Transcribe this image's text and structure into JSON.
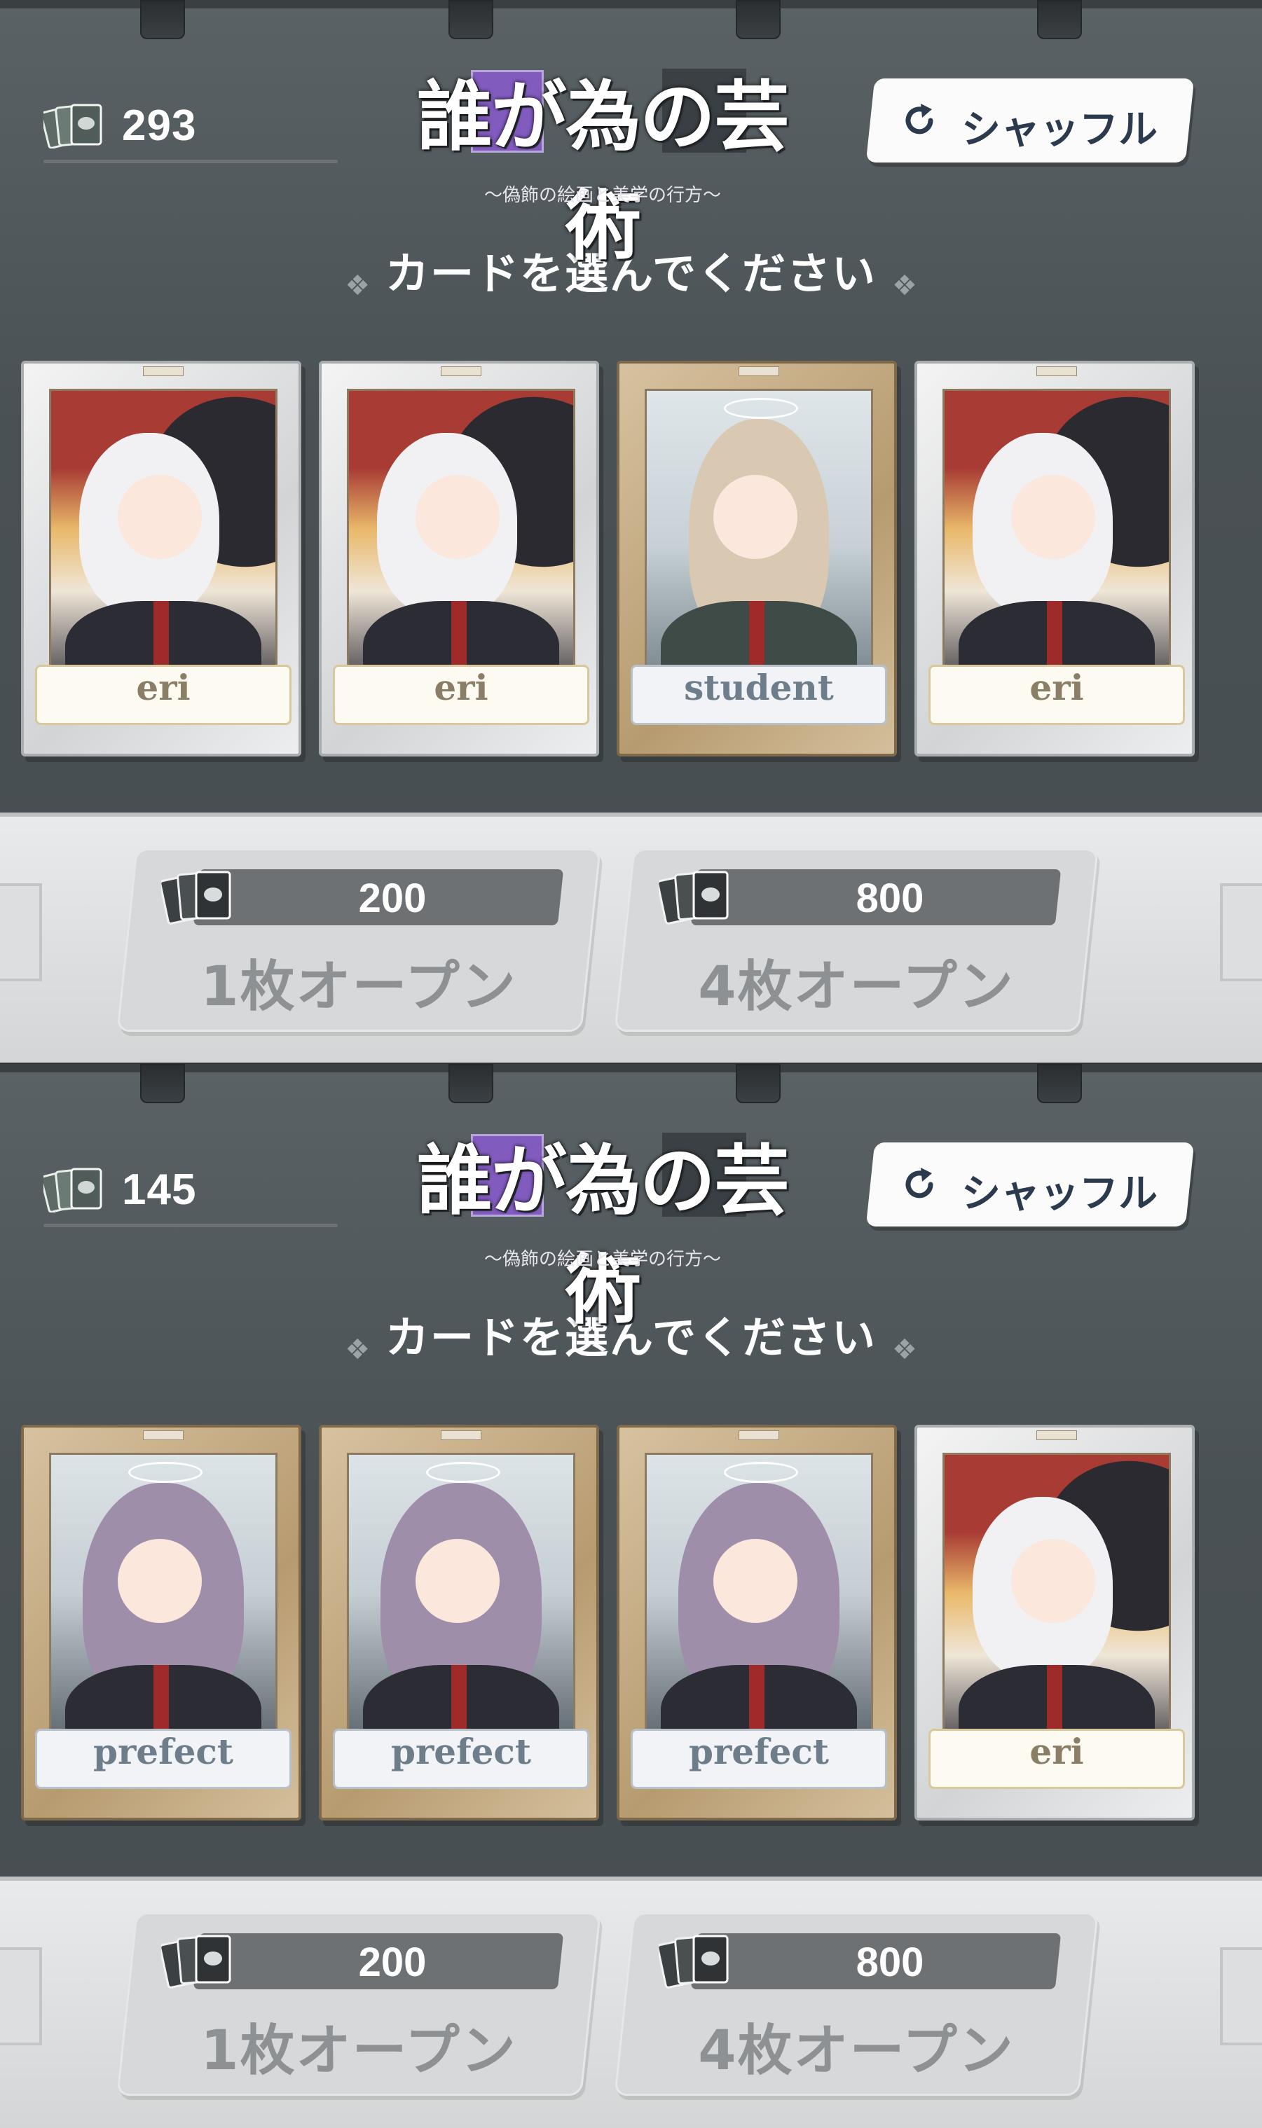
{
  "panels": [
    {
      "card_count": "293",
      "title": "誰が為の芸術",
      "subtitle": "～偽飾の絵画と美学の行方～",
      "shuffle_label": "シャッフル",
      "instruction": "カードを選んでください",
      "cards": [
        {
          "name": "eri",
          "frame": "silver",
          "art": "eri"
        },
        {
          "name": "eri",
          "frame": "silver",
          "art": "eri"
        },
        {
          "name": "student",
          "frame": "gold",
          "art": "student"
        },
        {
          "name": "eri",
          "frame": "silver",
          "art": "eri"
        }
      ],
      "open_buttons": [
        {
          "cost": "200",
          "label": "1枚オープン"
        },
        {
          "cost": "800",
          "label": "4枚オープン"
        }
      ]
    },
    {
      "card_count": "145",
      "title": "誰が為の芸術",
      "subtitle": "～偽飾の絵画と美学の行方～",
      "shuffle_label": "シャッフル",
      "instruction": "カードを選んでください",
      "cards": [
        {
          "name": "prefect",
          "frame": "gold",
          "art": "prefect"
        },
        {
          "name": "prefect",
          "frame": "gold",
          "art": "prefect"
        },
        {
          "name": "prefect",
          "frame": "gold",
          "art": "prefect"
        },
        {
          "name": "eri",
          "frame": "silver",
          "art": "eri"
        }
      ],
      "open_buttons": [
        {
          "cost": "200",
          "label": "1枚オープン"
        },
        {
          "cost": "800",
          "label": "4枚オープン"
        }
      ]
    }
  ],
  "icons": {
    "card_stack": "card-stack-icon",
    "shuffle": "refresh-icon"
  },
  "colors": {
    "background": "#4a5054",
    "shuffle_text": "#2c3a4d",
    "cost_bar": "#6d7174",
    "logo_accent": "#8a5bd0"
  }
}
